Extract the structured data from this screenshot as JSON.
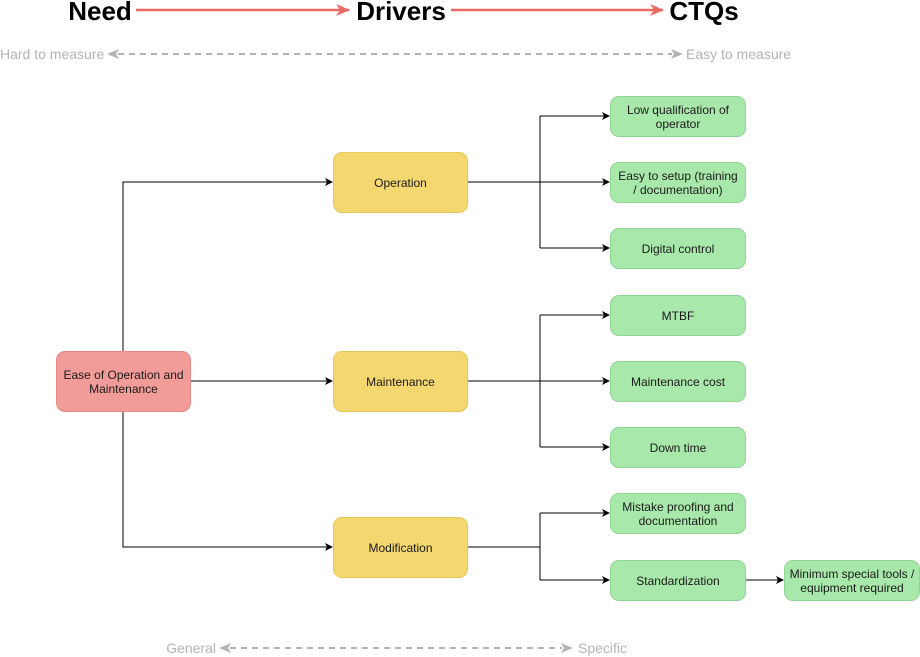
{
  "headers": {
    "need": "Need",
    "drivers": "Drivers",
    "ctqs": "CTQs"
  },
  "measure_axis": {
    "left": "Hard to measure",
    "right": "Easy to measure"
  },
  "specificity_axis": {
    "left": "General",
    "right": "Specific"
  },
  "colors": {
    "header_arrow": "#ea6b66",
    "need": "#f19c99",
    "driver": "#f4d76f",
    "ctq": "#a9e8ab",
    "axis": "#b3b3b3"
  },
  "root": {
    "label": "Ease of Operation and Maintenance"
  },
  "drivers": [
    {
      "label": "Operation",
      "ctqs": [
        "Low qualification of operator",
        "Easy to setup (training / documentation)",
        "Digital control"
      ]
    },
    {
      "label": "Maintenance",
      "ctqs": [
        "MTBF",
        "Maintenance cost",
        "Down time"
      ]
    },
    {
      "label": "Modification",
      "ctqs": [
        "Mistake proofing and documentation",
        "Standardization"
      ]
    }
  ],
  "sub_ctq": {
    "label": "Minimum special tools / equipment required"
  }
}
